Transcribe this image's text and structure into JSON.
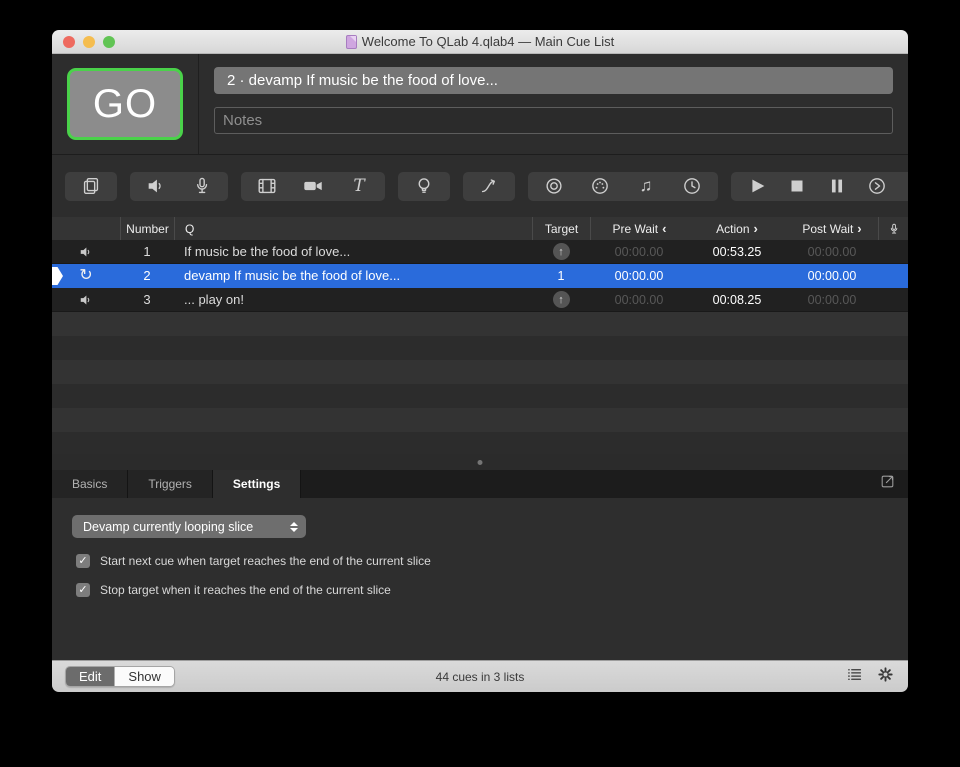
{
  "window": {
    "title": "Welcome To QLab 4.qlab4 — Main Cue List"
  },
  "header": {
    "go_label": "GO",
    "current_cue": "2 · devamp If music be the food of love...",
    "notes_placeholder": "Notes"
  },
  "toolbar": {
    "groups": [
      [
        "group-cue-icon"
      ],
      [
        "audio-cue-icon",
        "mic-cue-icon"
      ],
      [
        "video-cue-icon",
        "camera-cue-icon",
        "text-cue-icon"
      ],
      [
        "light-cue-icon"
      ],
      [
        "fade-cue-icon"
      ],
      [
        "network-cue-icon",
        "midi-cue-icon",
        "midi-file-cue-icon",
        "timecode-cue-icon"
      ],
      [
        "start-icon",
        "stop-icon",
        "pause-icon",
        "load-icon",
        "reset-icon",
        "devamp-icon",
        "goto-icon",
        "target-icon",
        "disarm-icon",
        "arm-icon",
        "wait-icon",
        "script-icon",
        "group-mode-icon"
      ]
    ],
    "glyphs": {
      "text_cue": "T",
      "midi_file": "♫",
      "reset": "↶",
      "devamp": "↻",
      "goto": "→"
    }
  },
  "cue_table": {
    "columns": {
      "number": "Number",
      "q": "Q",
      "target": "Target",
      "pre_wait": "Pre Wait",
      "action": "Action",
      "post_wait": "Post Wait",
      "pre_wait_chevron": "‹",
      "action_chevron": "›",
      "post_wait_chevron": "›"
    },
    "target_arrow_glyph": "↑",
    "rows": [
      {
        "number": "1",
        "name": "If music be the food of love...",
        "type": "audio",
        "target": "↑",
        "pre_wait": "00:00.00",
        "action": "00:53.25",
        "post_wait": "00:00.00"
      },
      {
        "number": "2",
        "name": "devamp If music be the food of love...",
        "type": "devamp",
        "target": "1",
        "pre_wait": "00:00.00",
        "action": "",
        "post_wait": "00:00.00"
      },
      {
        "number": "3",
        "name": "... play on!",
        "type": "audio",
        "target": "↑",
        "pre_wait": "00:00.00",
        "action": "00:08.25",
        "post_wait": "00:00.00"
      }
    ]
  },
  "inspector": {
    "tabs": [
      {
        "label": "Basics"
      },
      {
        "label": "Triggers"
      },
      {
        "label": "Settings"
      }
    ],
    "active_tab": "Settings",
    "settings": {
      "dropdown_value": "Devamp currently looping slice",
      "checkboxes": [
        {
          "label": "Start next cue when target reaches the end of the current slice",
          "checked": true,
          "mark": "✓"
        },
        {
          "label": "Stop target when it reaches the end of the current slice",
          "checked": true,
          "mark": "✓"
        }
      ]
    }
  },
  "status_bar": {
    "edit_label": "Edit",
    "show_label": "Show",
    "summary": "44 cues in 3 lists"
  },
  "colors": {
    "selected_row_blue": "#2a6bdb",
    "go_border_green": "#4ad24a",
    "traffic_red": "#ee6a5f",
    "traffic_yellow": "#f5bd4f",
    "traffic_green": "#61c454",
    "window_bg": "#2d2d2d",
    "row_bg": "#212121",
    "header_bg": "#343434"
  }
}
